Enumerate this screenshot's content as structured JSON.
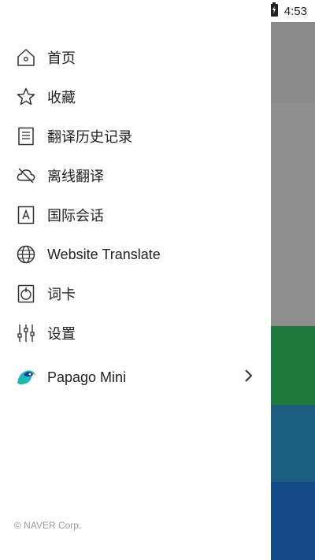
{
  "status_bar": {
    "time": "4:53"
  },
  "menu": [
    {
      "label": "首页",
      "icon": "home-icon"
    },
    {
      "label": "收藏",
      "icon": "star-icon"
    },
    {
      "label": "翻译历史记录",
      "icon": "history-icon"
    },
    {
      "label": "离线翻译",
      "icon": "offline-cloud-icon"
    },
    {
      "label": "国际会话",
      "icon": "conversation-icon"
    },
    {
      "label": "Website Translate",
      "icon": "globe-icon"
    },
    {
      "label": "词卡",
      "icon": "word-card-icon"
    },
    {
      "label": "设置",
      "icon": "settings-sliders-icon"
    },
    {
      "label": "Papago Mini",
      "icon": "papago-bird-icon"
    }
  ],
  "footer": {
    "copyright": "© NAVER Corp."
  },
  "colors": {
    "drawer_bg": "#ffffff",
    "overlay_gray": "#8a8a8a",
    "band_green": "#1f7a3f",
    "band_teal": "#1d5e80",
    "band_blue": "#134a8a"
  }
}
